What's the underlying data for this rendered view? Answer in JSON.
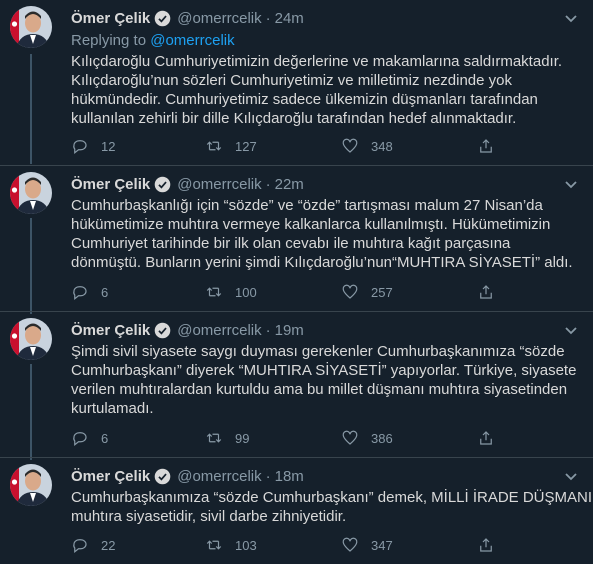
{
  "tweets": [
    {
      "name": "Ömer Çelik",
      "handle": "@omerrcelik",
      "separator": "·",
      "time": "24m",
      "reply_prefix": "Replying to",
      "reply_mention": "@omerrcelik",
      "lines": [
        "Kılıçdaroğlu Cumhuriyetimizin değerlerine ve makamlarına saldırmaktadır.",
        "Kılıçdaroğlu’nun sözleri Cumhuriyetimiz ve milletimiz nezdinde yok",
        "hükmündedir. Cumhuriyetimiz sadece ülkemizin düşmanları tarafından",
        "kullanılan zehirli bir dille Kılıçdaroğlu tarafından hedef alınmaktadır."
      ],
      "replies": "12",
      "retweets": "127",
      "likes": "348"
    },
    {
      "name": "Ömer Çelik",
      "handle": "@omerrcelik",
      "separator": "·",
      "time": "22m",
      "lines": [
        "Cumhurbaşkanlığı için “sözde” ve “özde” tartışması malum 27 Nisan’da",
        "hükümetimize muhtıra vermeye kalkanlarca kullanılmıştı. Hükümetimizin",
        "Cumhuriyet tarihinde bir ilk olan cevabı ile muhtıra kağıt parçasına",
        "dönmüştü. Bunların yerini şimdi Kılıçdaroğlu’nun“MUHTIRA SİYASETİ” aldı."
      ],
      "replies": "6",
      "retweets": "100",
      "likes": "257"
    },
    {
      "name": "Ömer Çelik",
      "handle": "@omerrcelik",
      "separator": "·",
      "time": "19m",
      "lines": [
        "Şimdi sivil siyasete saygı duyması gerekenler Cumhurbaşkanımıza “sözde",
        "Cumhurbaşkanı” diyerek “MUHTIRA SİYASETİ” yapıyorlar. Türkiye, siyasete",
        "verilen muhtıralardan kurtuldu ama bu millet düşmanı muhtıra siyasetinden",
        "kurtulamadı."
      ],
      "replies": "6",
      "retweets": "99",
      "likes": "386"
    },
    {
      "name": "Ömer Çelik",
      "handle": "@omerrcelik",
      "separator": "·",
      "time": "18m",
      "lines": [
        "Cumhurbaşkanımıza “sözde Cumhurbaşkanı” demek, MİLLİ İRADE DÜŞMANI",
        "muhtıra siyasetidir, sivil darbe zihniyetidir."
      ],
      "replies": "22",
      "retweets": "103",
      "likes": "347"
    }
  ],
  "colors": {
    "background": "#15202b",
    "text": "#d9d9d9",
    "muted": "#8899a6",
    "accent": "#1da1f2",
    "divider": "#38444d",
    "thread_line": "#3d5466"
  },
  "icons": {
    "verified": "verified-badge-icon",
    "more": "chevron-down-icon",
    "reply": "reply-icon",
    "retweet": "retweet-icon",
    "like": "heart-icon",
    "share": "share-icon"
  }
}
